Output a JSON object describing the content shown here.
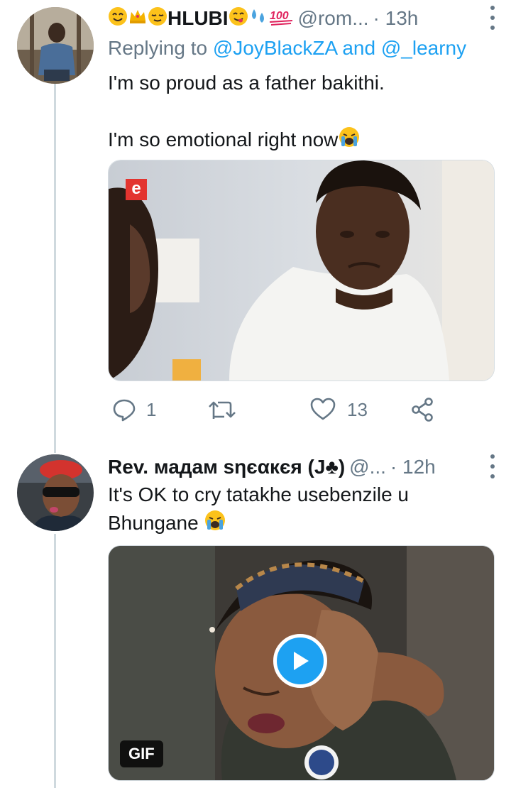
{
  "tweets": [
    {
      "display_name": "HLUBI",
      "handle": "@rom...",
      "time": "· 13h",
      "replying_prefix": "Replying to",
      "reply_mention_1": "@JoyBlackZA",
      "reply_and": "and",
      "reply_mention_2": "@_learny",
      "text_line_1": "I'm so proud as a father bakithi.",
      "text_line_2": "I'm so emotional right now",
      "media_badge": "e",
      "reply_count": "1",
      "retweet_count": "",
      "like_count": "13"
    },
    {
      "display_name": "Rev. мадам ѕηєαкєя (J♣)",
      "handle": "@...",
      "time": "· 12h",
      "text_line_1": "It's OK to cry tatakhe usebenzile u",
      "text_line_2": "Bhungane",
      "gif_label": "GIF"
    }
  ],
  "colors": {
    "accent": "#1da1f2",
    "muted": "#657786",
    "thread_line": "#cfd9de"
  },
  "icons": [
    "reply-icon",
    "retweet-icon",
    "like-icon",
    "share-icon",
    "play-icon",
    "more-icon"
  ]
}
